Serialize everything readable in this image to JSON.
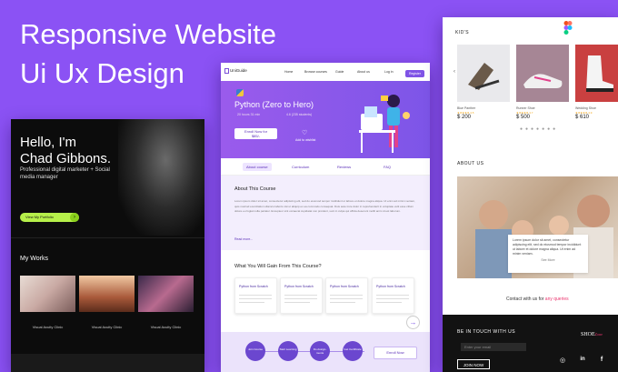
{
  "headline": {
    "line1": "Responsive Website",
    "line2": "Ui Ux Design"
  },
  "portfolio": {
    "greeting_line1": "Hello, I'm",
    "greeting_line2": "Chad Gibbons.",
    "role": "Professional digital marketer + Social media manager",
    "cta_label": "View My Portfolio",
    "works_title": "My Works",
    "works": [
      {
        "caption": "Visual Acuity Clinic"
      },
      {
        "caption": "Visual Acuity Clinic"
      },
      {
        "caption": "Visual Acuity Clinic"
      }
    ],
    "accent": "#b6f04a"
  },
  "course": {
    "logo": "UniGuide",
    "nav": [
      "Home",
      "Browse courses",
      "Guide",
      "About us",
      "Log in"
    ],
    "register_label": "Register",
    "title": "Python (Zero to Hero)",
    "meta_duration": "20 hours 31 min",
    "meta_rating": "4.6 (235 students)",
    "enroll_line1": "Enroll Now for",
    "enroll_price": "$85/-",
    "wishlist_label": "Add to wishlist",
    "tabs": [
      "About course",
      "Curriculum",
      "Reviews",
      "FAQ"
    ],
    "about_title": "About This Course",
    "about_body": "Lorem ipsum dolor sit amet, consectetur adipiscing elit, sed do eiusmod tempor incididunt ut labore et dolore magna aliqua. Ut enim ad minim veniam, quis nostrud exercitation ullamco laboris nisi ut aliquip ex ea commodo consequat. Duis aute irure dolor in reprehenderit in voluptate velit esse cillum dolore eu fugiat nulla pariatur. Excepteur sint occaecat cupidatat non proident, sunt in culpa qui officia deserunt mollit anim id est laborum.",
    "read_more": "Read more...",
    "gain_title": "What You Will Gain From This Course?",
    "cards": [
      {
        "title": "Python from Scratch"
      },
      {
        "title": "Python from Scratch"
      },
      {
        "title": "Python from Scratch"
      },
      {
        "title": "Python from Scratch"
      }
    ],
    "steps": [
      "Join Course",
      "Start Learning",
      "Do Assign-ments",
      "Get Certificate"
    ],
    "enroll2_label": "Enroll Now",
    "accent": "#7d55e8"
  },
  "shoe": {
    "kids_title": "KID'S",
    "products": [
      {
        "name": "Blue Panther",
        "stars": "★★★★★ 4.5",
        "price": "$ 200"
      },
      {
        "name": "Runner Shoe",
        "stars": "★★★★★ 4.7",
        "price": "$ 500"
      },
      {
        "name": "Wedding Shoe",
        "stars": "★★★★★ 4.9",
        "price": "$ 610"
      }
    ],
    "about_title": "ABOUT US",
    "about_text": "Lorem ipsum dolor sit amet, consectetur adipiscing elit, sed do eiusmod tempor incididunt ut labore et dolore magna aliqua. Ut enim ad minim veniam.",
    "see_more": "See More",
    "contact_prefix": "Contact with us for",
    "contact_accent": "any queries",
    "touch_title": "BE IN TOUCH WITH US",
    "email_placeholder": "Enter your email",
    "join_label": "JOIN NOW",
    "brand": "SHOE",
    "brand_suffix": "Zone",
    "social_icons": [
      "instagram-icon",
      "linkedin-icon",
      "facebook-icon"
    ],
    "accent": "#ec3770"
  }
}
